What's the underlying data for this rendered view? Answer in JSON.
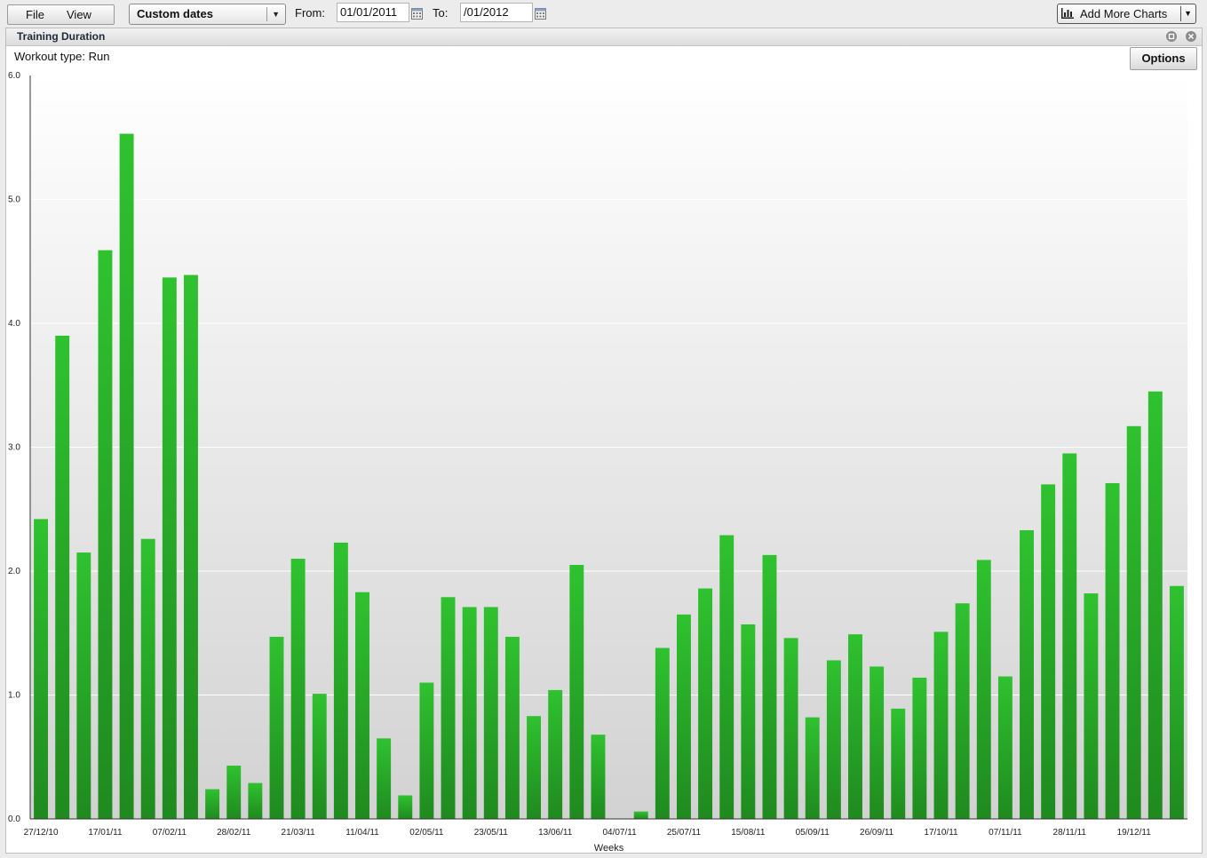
{
  "toolbar": {
    "file_label": "File",
    "view_label": "View",
    "date_range_select": "Custom dates",
    "from_label": "From:",
    "from_value": "01/01/2011",
    "to_label": "To:",
    "to_value": "/01/2012",
    "add_charts_label": "Add More Charts"
  },
  "panel": {
    "title": "Training Duration",
    "subtitle": "Workout type: Run",
    "options_label": "Options"
  },
  "colors": {
    "bar_light": "#2fc22f",
    "bar_dark": "#1f8a1f",
    "plot_top": "#ffffff",
    "plot_bottom": "#d2d2d2"
  },
  "chart_data": {
    "type": "bar",
    "title": "Training Duration",
    "xlabel": "Weeks",
    "ylabel": "",
    "ylim": [
      0,
      6
    ],
    "yticks": [
      "0.0",
      "1.0",
      "2.0",
      "3.0",
      "4.0",
      "5.0",
      "6.0"
    ],
    "grid": true,
    "legend": "none",
    "x_tick_labels": [
      "27/12/10",
      "17/01/11",
      "07/02/11",
      "28/02/11",
      "21/03/11",
      "11/04/11",
      "02/05/11",
      "23/05/11",
      "13/06/11",
      "04/07/11",
      "25/07/11",
      "15/08/11",
      "05/09/11",
      "26/09/11",
      "17/10/11",
      "07/11/11",
      "28/11/11",
      "19/12/11"
    ],
    "values": [
      2.42,
      3.9,
      2.15,
      4.59,
      5.53,
      2.26,
      4.37,
      4.39,
      0.24,
      0.43,
      0.29,
      1.47,
      2.1,
      1.01,
      2.23,
      1.83,
      0.65,
      0.19,
      1.1,
      1.79,
      1.71,
      1.71,
      1.47,
      0.83,
      1.04,
      2.05,
      0.68,
      0,
      0.06,
      1.38,
      1.65,
      1.86,
      2.29,
      1.57,
      2.13,
      1.46,
      0.82,
      1.28,
      1.49,
      1.23,
      0.89,
      1.14,
      1.51,
      1.74,
      2.09,
      1.15,
      2.33,
      2.7,
      2.95,
      1.82,
      2.71,
      3.17,
      3.45,
      1.88
    ]
  }
}
